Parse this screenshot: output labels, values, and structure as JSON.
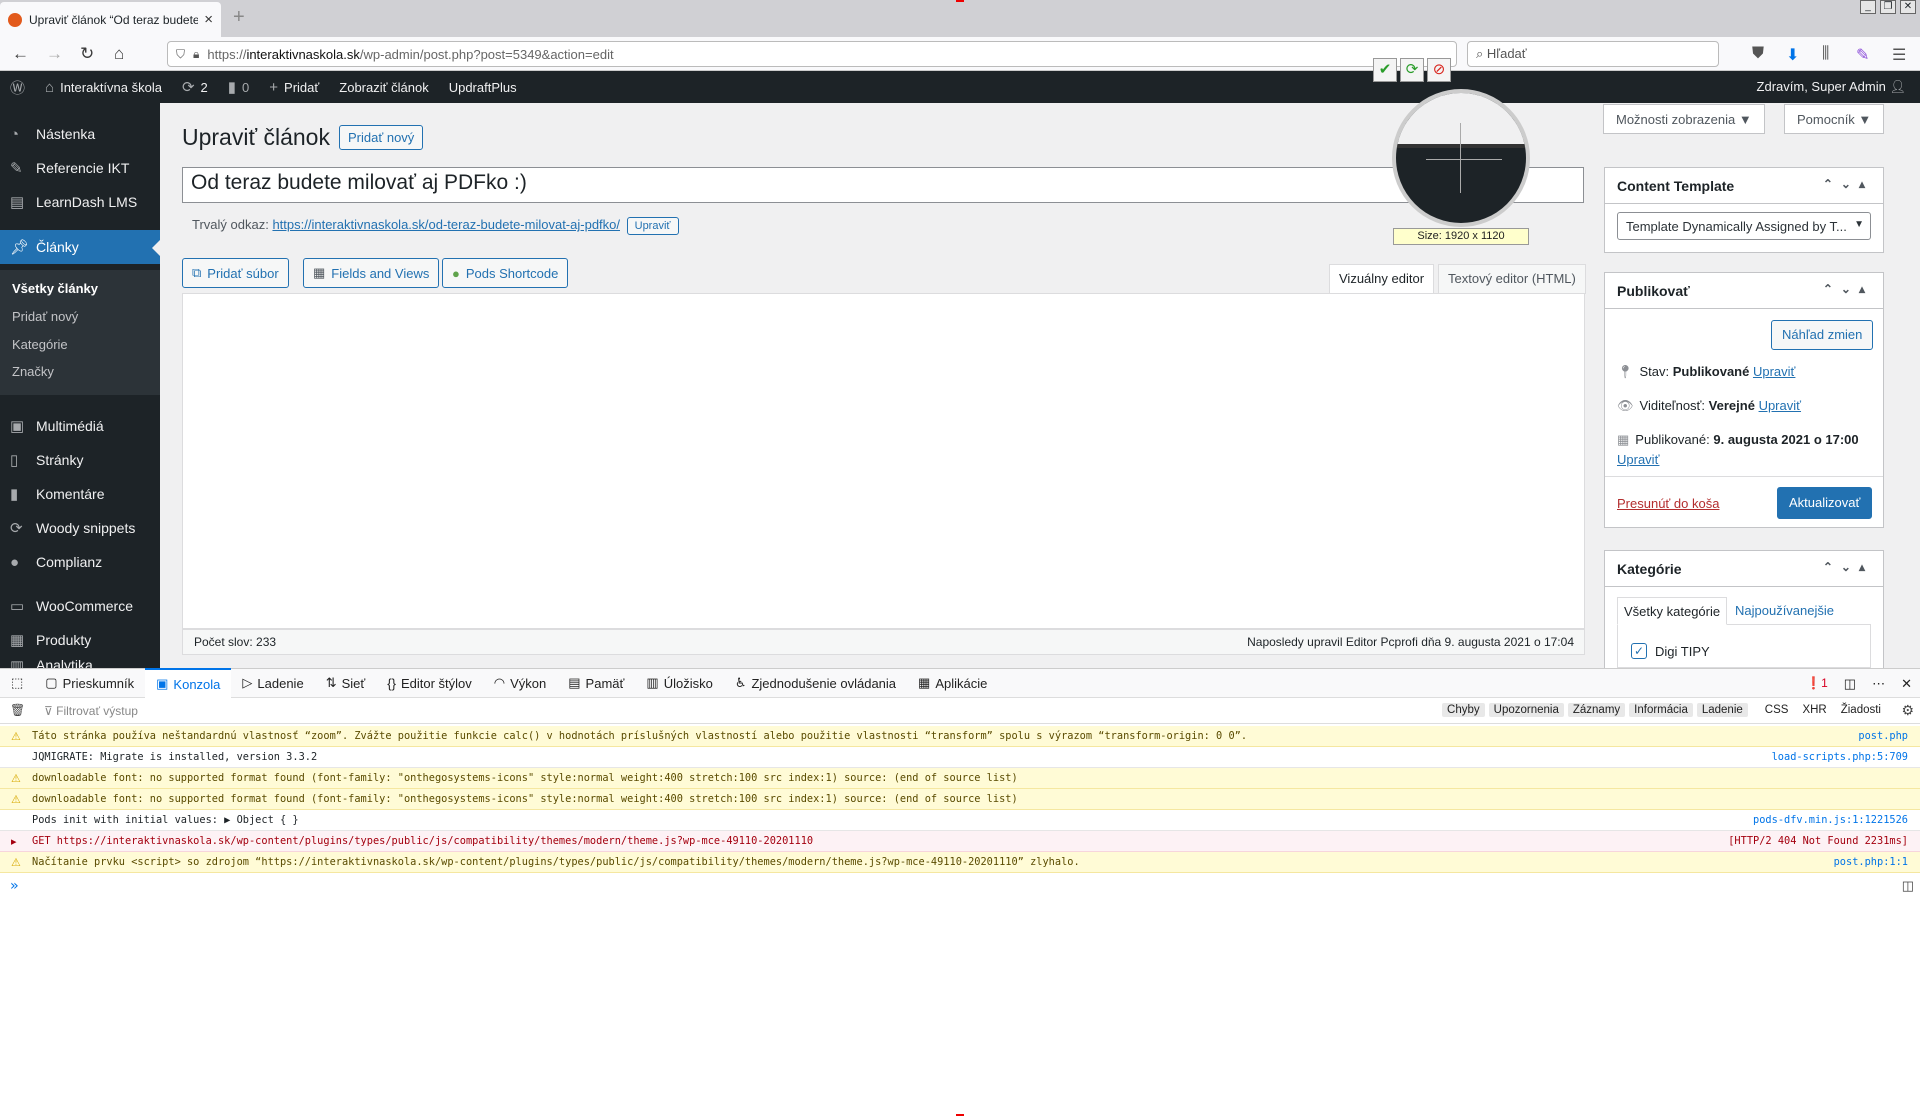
{
  "browser": {
    "tab_title": "Upraviť článok “Od teraz budete m",
    "url_prefix": "https://",
    "url_domain": "interaktivnaskola.sk",
    "url_path": "/wp-admin/post.php?post=5349&action=edit",
    "search_placeholder": "Hľadať"
  },
  "adminbar": {
    "site": "Interaktívna škola",
    "updates": "2",
    "comments": "0",
    "new": "Pridať",
    "view": "Zobraziť článok",
    "updraft": "UpdraftPlus",
    "greeting": "Zdravím, Super Admin"
  },
  "sidebar": {
    "items": [
      {
        "label": "Nástenka"
      },
      {
        "label": "Referencie IKT"
      },
      {
        "label": "LearnDash LMS"
      },
      {
        "label": "Články"
      },
      {
        "label": "Multimédiá"
      },
      {
        "label": "Stránky"
      },
      {
        "label": "Komentáre"
      },
      {
        "label": "Woody snippets"
      },
      {
        "label": "Complianz"
      },
      {
        "label": "WooCommerce"
      },
      {
        "label": "Produkty"
      },
      {
        "label": "Analytika"
      }
    ],
    "sub": [
      "Všetky články",
      "Pridať nový",
      "Kategórie",
      "Značky"
    ]
  },
  "editor": {
    "heading": "Upraviť článok",
    "add_new": "Pridať nový",
    "title_value": "Od teraz budete milovať aj PDFko :)",
    "permalink_label": "Trvalý odkaz:",
    "permalink_url": "https://interaktivnaskola.sk/od-teraz-budete-milovat-aj-pdfko/",
    "permalink_edit": "Upraviť",
    "media_buttons": [
      "Pridať súbor",
      "Fields and Views",
      "Pods Shortcode"
    ],
    "tab_visual": "Vizuálny editor",
    "tab_text": "Textový editor (HTML)",
    "word_count": "Počet slov: 233",
    "last_edit": "Naposledy upravil Editor Pcprofi dňa 9. augusta 2021 o 17:04"
  },
  "screen": {
    "options": "Možnosti zobrazenia ▼",
    "help": "Pomocník ▼"
  },
  "content_template": {
    "title": "Content Template",
    "select": "Template Dynamically Assigned by T..."
  },
  "publish": {
    "title": "Publikovať",
    "preview": "Náhľad zmien",
    "status_label": "Stav:",
    "status_value": "Publikované",
    "visibility_label": "Viditeľnosť:",
    "visibility_value": "Verejné",
    "published_label": "Publikované:",
    "published_value": "9. augusta 2021 o 17:00",
    "edit": "Upraviť",
    "trash": "Presunúť do koša",
    "update": "Aktualizovať"
  },
  "categories": {
    "title": "Kategórie",
    "tab_all": "Všetky kategórie",
    "tab_popular": "Najpoužívanejšie",
    "item": "Digi TIPY"
  },
  "magnifier": {
    "size_label": "Size: 1920 x 1120"
  },
  "devtools": {
    "tabs": [
      "Prieskumník",
      "Konzola",
      "Ladenie",
      "Sieť",
      "Editor štýlov",
      "Výkon",
      "Pamäť",
      "Úložisko",
      "Zjednodušenie ovládania",
      "Aplikácie"
    ],
    "error_count": "1",
    "filter_placeholder": "Filtrovať výstup",
    "filters": [
      "Chyby",
      "Upozornenia",
      "Záznamy",
      "Informácia",
      "Ladenie",
      "CSS",
      "XHR",
      "Žiadosti"
    ],
    "log": [
      {
        "type": "warn",
        "text": "Táto stránka používa neštandardnú vlastnosť “zoom”. Zvážte použitie funkcie calc() v hodnotách príslušných vlastností alebo použitie vlastnosti “transform” spolu s výrazom “transform-origin: 0 0”.",
        "src": "post.php"
      },
      {
        "type": "log",
        "text": "JQMIGRATE: Migrate is installed, version 3.3.2",
        "src": "load-scripts.php:5:709"
      },
      {
        "type": "warn",
        "text": "downloadable font: no supported format found (font-family: \"onthegosystems-icons\" style:normal weight:400 stretch:100 src index:1) source: (end of source list)",
        "src": ""
      },
      {
        "type": "warn",
        "text": "downloadable font: no supported format found (font-family: \"onthegosystems-icons\" style:normal weight:400 stretch:100 src index:1) source: (end of source list)",
        "src": ""
      },
      {
        "type": "log",
        "text": "Pods init with initial values: ▶ Object {  }",
        "src": "pods-dfv.min.js:1:1221526"
      },
      {
        "type": "err",
        "text": "GET https://interaktivnaskola.sk/wp-content/plugins/types/public/js/compatibility/themes/modern/theme.js?wp-mce-49110-20201110",
        "src": "[HTTP/2 404 Not Found 2231ms]"
      },
      {
        "type": "warn",
        "text": "Načítanie prvku <script> so zdrojom “https://interaktivnaskola.sk/wp-content/plugins/types/public/js/compatibility/themes/modern/theme.js?wp-mce-49110-20201110” zlyhalo.",
        "src": "post.php:1:1"
      }
    ]
  }
}
